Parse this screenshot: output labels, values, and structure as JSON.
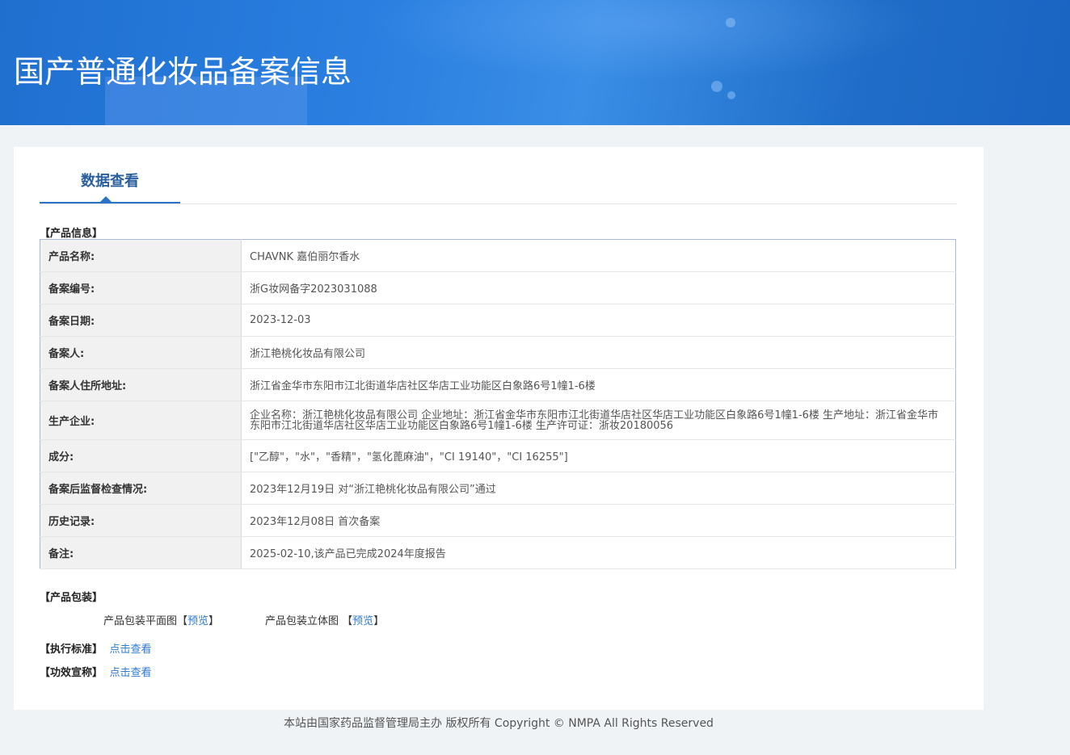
{
  "header": {
    "title": "国产普通化妆品备案信息"
  },
  "tabs": [
    {
      "label": "数据查看",
      "active": true
    }
  ],
  "product_info": {
    "section_label": "【产品信息】",
    "rows": [
      {
        "key": "产品名称:",
        "value": "CHAVNK 嘉伯丽尔香水"
      },
      {
        "key": "备案编号:",
        "value": "浙G妆网备字2023031088"
      },
      {
        "key": "备案日期:",
        "value": "2023-12-03"
      },
      {
        "key": "备案人:",
        "value": "浙江艳桃化妆品有限公司"
      },
      {
        "key": "备案人住所地址:",
        "value": "浙江省金华市东阳市江北街道华店社区华店工业功能区白象路6号1幢1-6楼"
      },
      {
        "key": "生产企业:",
        "value": "企业名称：浙江艳桃化妆品有限公司 企业地址：浙江省金华市东阳市江北街道华店社区华店工业功能区白象路6号1幢1-6楼 生产地址：浙江省金华市东阳市江北街道华店社区华店工业功能区白象路6号1幢1-6楼 生产许可证：浙妆20180056"
      },
      {
        "key": "成分:",
        "value": "[\"乙醇\"，\"水\"，\"香精\"，\"氢化蓖麻油\"，\"CI 19140\"，\"CI 16255\"]"
      },
      {
        "key": "备案后监督检查情况:",
        "value": "2023年12月19日 对“浙江艳桃化妆品有限公司”通过"
      },
      {
        "key": "历史记录:",
        "value": "2023年12月08日 首次备案"
      },
      {
        "key": "备注:",
        "value": "2025-02-10,该产品已完成2024年度报告"
      }
    ]
  },
  "packaging": {
    "section_label": "【产品包装】",
    "flat_label": "产品包装平面图",
    "flat_open": "【",
    "flat_link": "预览",
    "flat_close": "】",
    "three_d_label": "产品包装立体图",
    "three_d_open": "【",
    "three_d_link": "预览",
    "three_d_close": "】"
  },
  "standard": {
    "label": "【执行标准】",
    "link": "点击查看"
  },
  "efficacy": {
    "label": "【功效宣称】",
    "link": "点击查看"
  },
  "footer": {
    "text": "本站由国家药品监督管理局主办 版权所有 Copyright © NMPA All Rights Reserved"
  },
  "colors": {
    "banner": "#2a7fe0",
    "accent": "#2b73c6",
    "link": "#2e7bd0",
    "table_border": "#a9bad1"
  }
}
